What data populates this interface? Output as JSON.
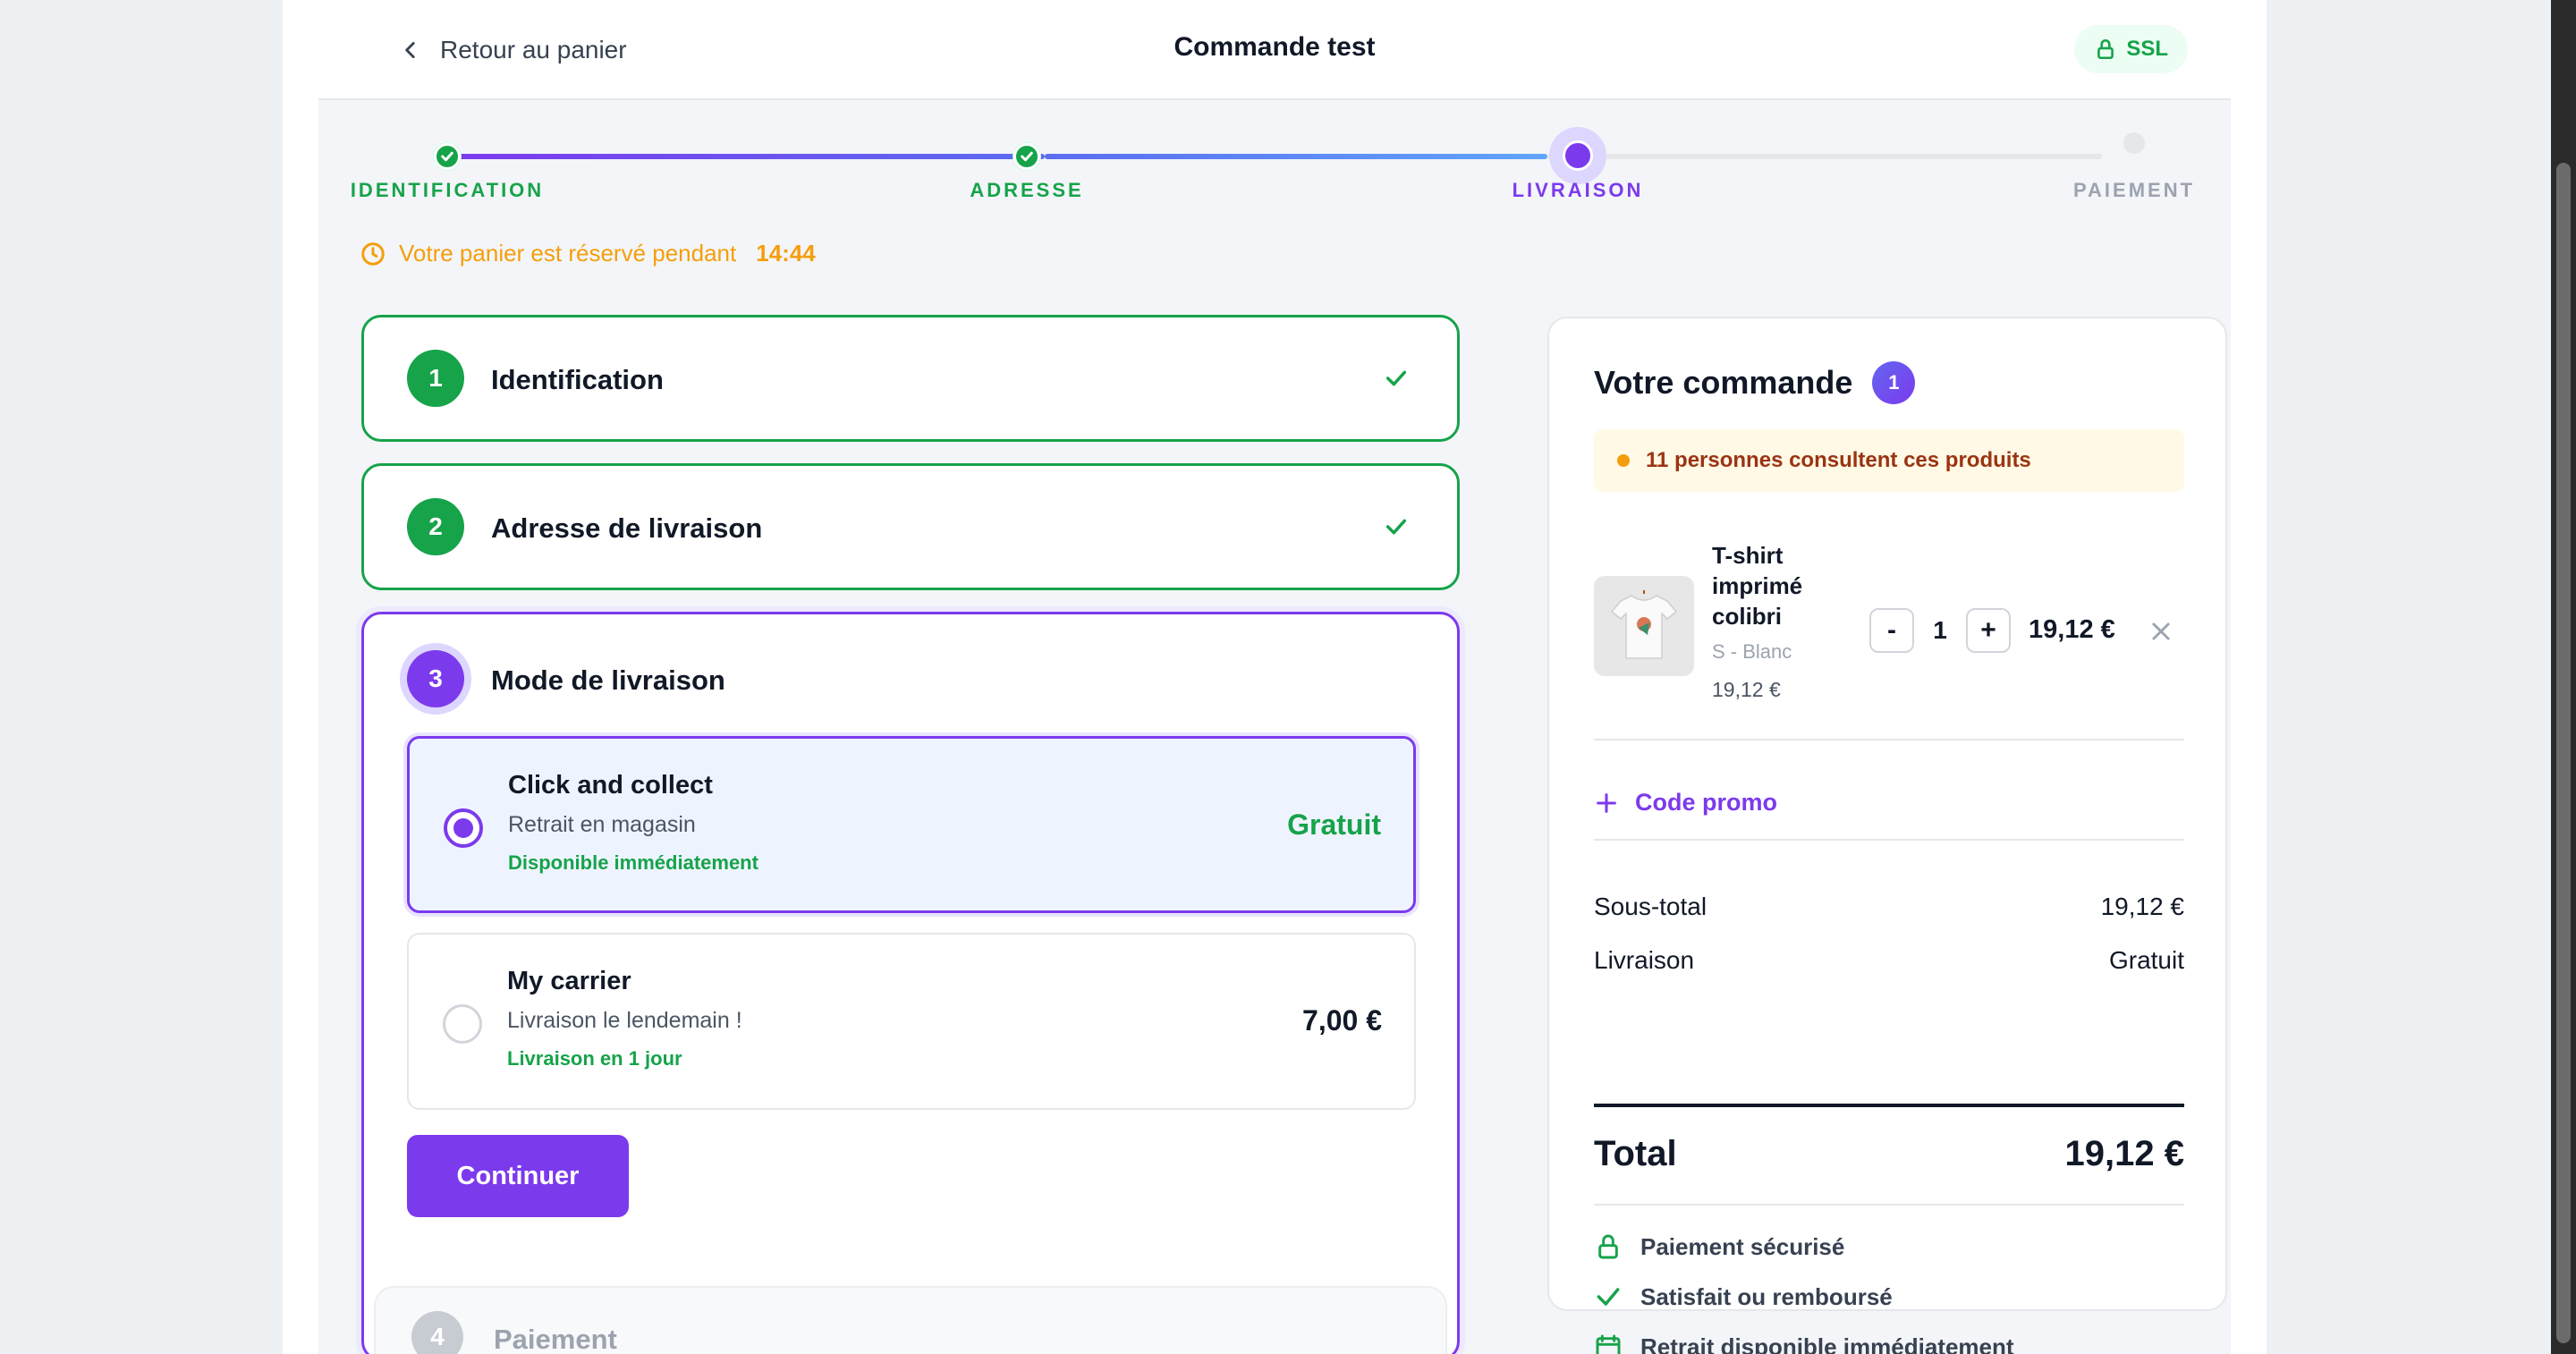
{
  "header": {
    "back_label": "Retour au panier",
    "title": "Commande test",
    "ssl_label": "SSL"
  },
  "stepper": {
    "steps": [
      {
        "label": "IDENTIFICATION",
        "state": "done"
      },
      {
        "label": "ADRESSE",
        "state": "done"
      },
      {
        "label": "LIVRAISON",
        "state": "active"
      },
      {
        "label": "PAIEMENT",
        "state": "todo"
      }
    ]
  },
  "timer": {
    "text": "Votre panier est réservé pendant",
    "time": "14:44"
  },
  "sections": [
    {
      "number": "1",
      "title": "Identification",
      "state": "done"
    },
    {
      "number": "2",
      "title": "Adresse de livraison",
      "state": "done"
    },
    {
      "number": "3",
      "title": "Mode de livraison",
      "state": "active"
    },
    {
      "number": "4",
      "title": "Paiement",
      "state": "pending"
    }
  ],
  "shipping_options": [
    {
      "name": "Click and collect",
      "description": "Retrait en magasin",
      "delay": "Disponible immédiatement",
      "price": "Gratuit",
      "selected": true
    },
    {
      "name": "My carrier",
      "description": "Livraison le lendemain !",
      "delay": "Livraison en 1 jour",
      "price": "7,00 €",
      "selected": false
    }
  ],
  "continue_label": "Continuer",
  "summary": {
    "title": "Votre commande",
    "count": "1",
    "viewers": "11 personnes consultent ces produits",
    "item": {
      "name": "T-shirt imprimé colibri",
      "variant": "S - Blanc",
      "unit_price": "19,12 €",
      "qty_minus": "-",
      "qty": "1",
      "qty_plus": "+",
      "line_total": "19,12 €"
    },
    "promo_label": "Code promo",
    "subtotal_label": "Sous-total",
    "subtotal_value": "19,12 €",
    "shipping_label": "Livraison",
    "shipping_value": "Gratuit",
    "total_label": "Total",
    "total_value": "19,12 €",
    "trust": [
      "Paiement sécurisé",
      "Satisfait ou remboursé",
      "Retrait disponible immédiatement"
    ]
  },
  "colors": {
    "accent": "#7c3aed",
    "success": "#16a34a",
    "warning": "#f59e0b",
    "progress_blue": "#4f8ef7"
  }
}
